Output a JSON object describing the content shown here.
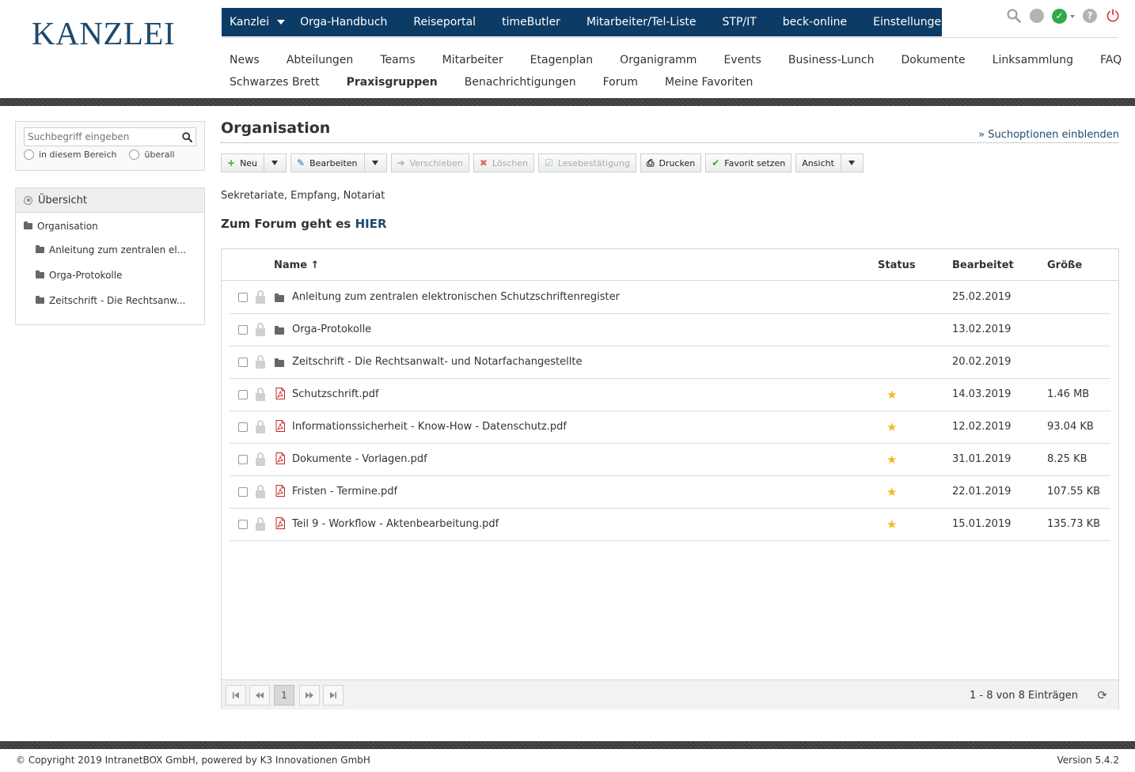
{
  "logo": "KANZLEI",
  "topnav": {
    "items": [
      {
        "label": "Kanzlei",
        "dropdown": true
      },
      {
        "label": "Orga-Handbuch",
        "dropdown": false
      },
      {
        "label": "Reiseportal",
        "dropdown": false
      },
      {
        "label": "timeButler",
        "dropdown": false
      },
      {
        "label": "Mitarbeiter/Tel-Liste",
        "dropdown": false
      },
      {
        "label": "STP/IT",
        "dropdown": false
      },
      {
        "label": "beck-online",
        "dropdown": false
      },
      {
        "label": "Einstellungen",
        "dropdown": true
      }
    ],
    "background": "#0c3b66"
  },
  "subnav": {
    "row1": [
      "News",
      "Abteilungen",
      "Teams",
      "Mitarbeiter",
      "Etagenplan",
      "Organigramm",
      "Events",
      "Business-Lunch",
      "Dokumente",
      "Linksammlung",
      "FAQ"
    ],
    "row2": [
      "Schwarzes Brett",
      "Praxisgruppen",
      "Benachrichtigungen",
      "Forum",
      "Meine Favoriten"
    ],
    "active": "Praxisgruppen"
  },
  "search": {
    "placeholder": "Suchbegriff eingeben",
    "scope_here": "in diesem Bereich",
    "scope_all": "überall"
  },
  "tree": {
    "header": "Übersicht",
    "root": "Organisation",
    "children": [
      "Anleitung zum zentralen el...",
      "Orga-Protokolle",
      "Zeitschrift - Die Rechtsanw..."
    ]
  },
  "main": {
    "title": "Organisation",
    "search_options": "» Suchoptionen einblenden",
    "toolbar": {
      "new": "Neu",
      "edit": "Bearbeiten",
      "move": "Verschieben",
      "delete": "Löschen",
      "read_confirm": "Lesebestätigung",
      "print": "Drucken",
      "favorite": "Favorit setzen",
      "view": "Ansicht"
    },
    "description": "Sekretariate, Empfang, Notariat",
    "forum_text": "Zum Forum geht es",
    "forum_link": "HIER"
  },
  "grid": {
    "columns": {
      "name": "Name",
      "sort_arrow": "↑",
      "status": "Status",
      "edited": "Bearbeitet",
      "size": "Größe"
    },
    "rows": [
      {
        "type": "folder",
        "name": "Anleitung zum zentralen elektronischen Schutzschriftenregister",
        "favorite": false,
        "date": "25.02.2019",
        "size": ""
      },
      {
        "type": "folder",
        "name": "Orga-Protokolle",
        "favorite": false,
        "date": "13.02.2019",
        "size": ""
      },
      {
        "type": "folder",
        "name": "Zeitschrift - Die Rechtsanwalt- und Notarfachangestellte",
        "favorite": false,
        "date": "20.02.2019",
        "size": ""
      },
      {
        "type": "pdf",
        "name": "Schutzschrift.pdf",
        "favorite": true,
        "date": "14.03.2019",
        "size": "1.46 MB"
      },
      {
        "type": "pdf",
        "name": "Informationssicherheit - Know-How - Datenschutz.pdf",
        "favorite": true,
        "date": "12.02.2019",
        "size": "93.04 KB"
      },
      {
        "type": "pdf",
        "name": "Dokumente - Vorlagen.pdf",
        "favorite": true,
        "date": "31.01.2019",
        "size": "8.25 KB"
      },
      {
        "type": "pdf",
        "name": "Fristen - Termine.pdf",
        "favorite": true,
        "date": "22.01.2019",
        "size": "107.55 KB"
      },
      {
        "type": "pdf",
        "name": "Teil 9 - Workflow - Aktenbearbeitung.pdf",
        "favorite": true,
        "date": "15.01.2019",
        "size": "135.73 KB"
      }
    ],
    "pager": {
      "current_page": "1",
      "info": "1 - 8 von 8 Einträgen"
    }
  },
  "footer": {
    "copyright": "© Copyright 2019 IntranetBOX GmbH, powered by K3 Innovationen GmbH",
    "version": "Version 5.4.2"
  },
  "colors": {
    "brand": "#1d4a6e",
    "star": "#f2b824",
    "pdf": "#c62828",
    "status_ok": "#2eab4b"
  }
}
